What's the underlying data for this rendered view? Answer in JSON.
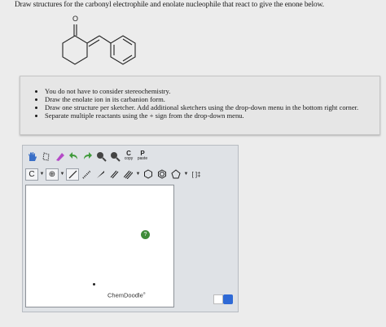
{
  "question": "Draw structures for the carbonyl electrophile and enolate nucleophile that react to give the enone below.",
  "molecule": {
    "oxygen_label": "O"
  },
  "instructions": [
    "You do not have to consider stereochemistry.",
    "Draw the enolate ion in its carbanion form.",
    "Draw one structure per sketcher. Add additional sketchers using the drop-down menu in the bottom right corner.",
    "Separate multiple reactants using the + sign from the drop-down menu."
  ],
  "toolbar": {
    "copy_letter": "C",
    "copy_label": "copy",
    "paste_letter": "P",
    "paste_label": "paste",
    "element_label": "C",
    "charge_label": "⊕",
    "bracket_label": "[ ]‡"
  },
  "canvas": {
    "green_button_label": "?"
  },
  "brand": {
    "name": "ChemDoodle",
    "mark": "®"
  },
  "colors": {
    "accent_blue": "#2e69d6",
    "green": "#3f8c3a"
  }
}
